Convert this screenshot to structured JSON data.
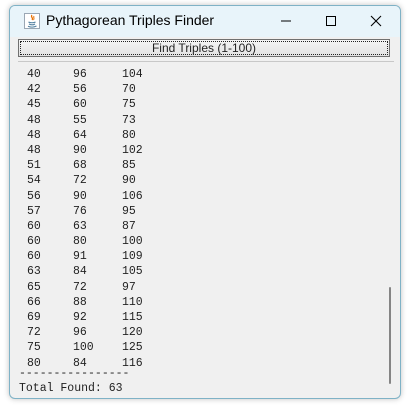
{
  "window": {
    "title": "Pythagorean Triples Finder",
    "controls": {
      "minimize_icon": "minimize-icon",
      "maximize_icon": "maximize-icon",
      "close_icon": "close-icon"
    }
  },
  "toolbar": {
    "find_label": "Find Triples (1-100)"
  },
  "results": {
    "rows": [
      [
        "40",
        "96",
        "104"
      ],
      [
        "42",
        "56",
        "70"
      ],
      [
        "45",
        "60",
        "75"
      ],
      [
        "48",
        "55",
        "73"
      ],
      [
        "48",
        "64",
        "80"
      ],
      [
        "48",
        "90",
        "102"
      ],
      [
        "51",
        "68",
        "85"
      ],
      [
        "54",
        "72",
        "90"
      ],
      [
        "56",
        "90",
        "106"
      ],
      [
        "57",
        "76",
        "95"
      ],
      [
        "60",
        "63",
        "87"
      ],
      [
        "60",
        "80",
        "100"
      ],
      [
        "60",
        "91",
        "109"
      ],
      [
        "63",
        "84",
        "105"
      ],
      [
        "65",
        "72",
        "97"
      ],
      [
        "66",
        "88",
        "110"
      ],
      [
        "69",
        "92",
        "115"
      ],
      [
        "72",
        "96",
        "120"
      ],
      [
        "75",
        "100",
        "125"
      ],
      [
        "80",
        "84",
        "116"
      ]
    ],
    "separator": "----------------",
    "total": "Total Found: 63"
  },
  "colors": {
    "window_bg": "#f0f0f0",
    "titlebar_bg": "#e8f4fa",
    "java_icon_red": "#e76f00",
    "java_icon_blue": "#5382a1"
  }
}
